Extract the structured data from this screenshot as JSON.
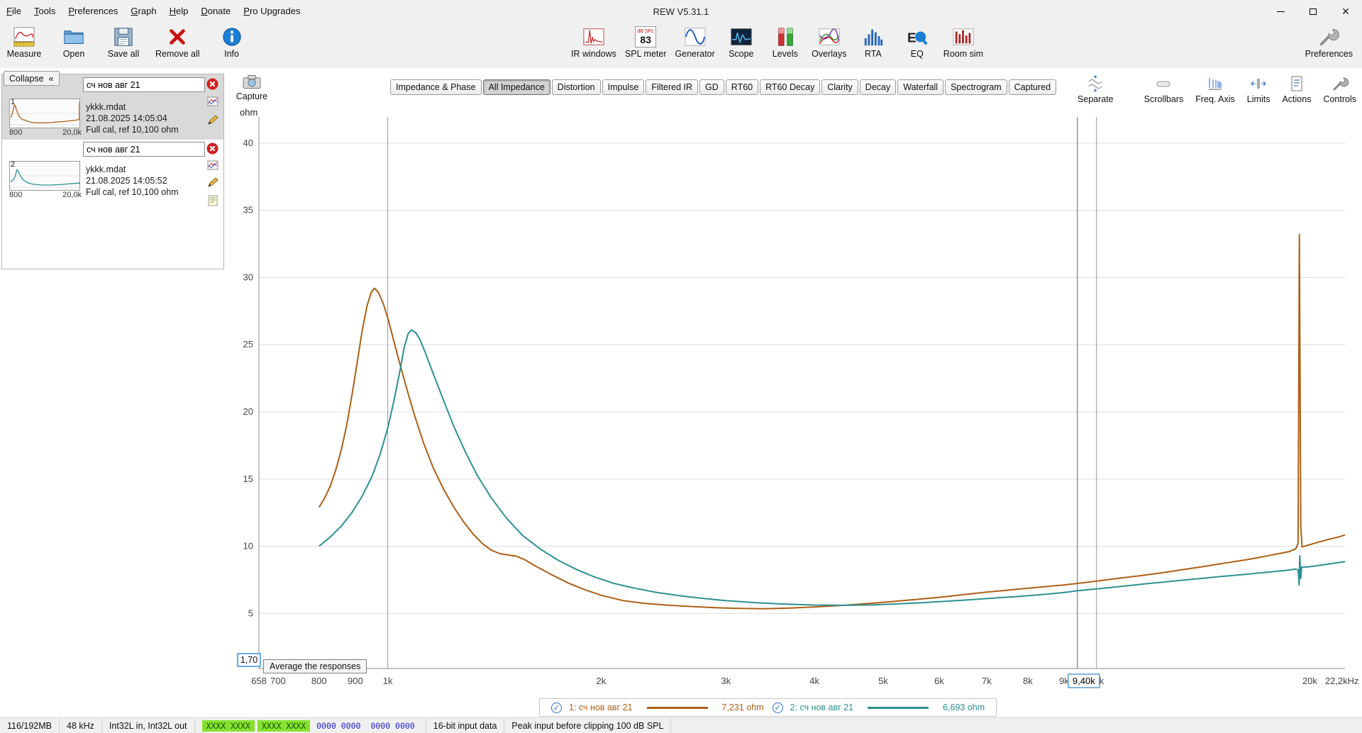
{
  "window": {
    "title": "REW V5.31.1"
  },
  "menu": {
    "items": [
      "File",
      "Tools",
      "Preferences",
      "Graph",
      "Help",
      "Donate",
      "Pro Upgrades"
    ]
  },
  "toolbar": {
    "left": [
      {
        "label": "Measure"
      },
      {
        "label": "Open"
      },
      {
        "label": "Save all"
      },
      {
        "label": "Remove all"
      },
      {
        "label": "Info"
      }
    ],
    "center": [
      {
        "label": "IR windows"
      },
      {
        "label": "SPL meter",
        "badge_top": "dB SPL",
        "badge_value": "83"
      },
      {
        "label": "Generator"
      },
      {
        "label": "Scope"
      },
      {
        "label": "Levels"
      },
      {
        "label": "Overlays"
      },
      {
        "label": "RTA"
      },
      {
        "label": "EQ"
      },
      {
        "label": "Room sim"
      }
    ],
    "right": [
      {
        "label": "Preferences"
      }
    ]
  },
  "sidebar": {
    "collapse_label": "Collapse",
    "entries": [
      {
        "index": "1",
        "name": "сч нов авг 21",
        "file": "ykkk.mdat",
        "timestamp": "21.08.2025 14:05:04",
        "cal": "Full cal, ref 10,100 ohm",
        "thumb_min": "800",
        "thumb_max": "20,0k"
      },
      {
        "index": "2",
        "name": "сч нов авг 21",
        "file": "ykkk.mdat",
        "timestamp": "21.08.2025 14:05:52",
        "cal": "Full cal, ref 10,100 ohm",
        "thumb_min": "800",
        "thumb_max": "20,0k"
      }
    ]
  },
  "graph_header": {
    "capture_label": "Capture",
    "tabs": [
      "Impedance & Phase",
      "All Impedance",
      "Distortion",
      "Impulse",
      "Filtered IR",
      "GD",
      "RT60",
      "RT60 Decay",
      "Clarity",
      "Decay",
      "Waterfall",
      "Spectrogram",
      "Captured"
    ],
    "selected_tab": "All Impedance",
    "right_buttons": [
      "Separate",
      "Scrollbars",
      "Freq. Axis",
      "Limits",
      "Actions",
      "Controls"
    ]
  },
  "graph_footer": {
    "axis_min_value": "1,70",
    "tooltip": "Average the responses"
  },
  "chart_data": {
    "type": "line",
    "title": "",
    "xlabel": "Hz",
    "ylabel": "ohm",
    "x_scale": "log",
    "grid": true,
    "legend_position": "bottom",
    "xlim": [
      658,
      22420
    ],
    "ylim": [
      0.9,
      41.95
    ],
    "y_ticks": [
      5,
      10,
      15,
      20,
      25,
      30,
      35,
      40
    ],
    "x_ticks": [
      {
        "f": 658,
        "label": "658"
      },
      {
        "f": 700,
        "label": "700"
      },
      {
        "f": 800,
        "label": "800"
      },
      {
        "f": 900,
        "label": "900"
      },
      {
        "f": 1000,
        "label": "1k"
      },
      {
        "f": 2000,
        "label": "2k"
      },
      {
        "f": 3000,
        "label": "3k"
      },
      {
        "f": 4000,
        "label": "4k"
      },
      {
        "f": 5000,
        "label": "5k"
      },
      {
        "f": 6000,
        "label": "6k"
      },
      {
        "f": 7000,
        "label": "7k"
      },
      {
        "f": 8000,
        "label": "8k"
      },
      {
        "f": 9000,
        "label": "9k"
      },
      {
        "f": 10000,
        "label": "10k"
      },
      {
        "f": 20000,
        "label": "20k"
      },
      {
        "f": 22200,
        "label": "22,2kHz"
      }
    ],
    "decade_gridlines": [
      1000,
      10000
    ],
    "cursor": {
      "freq": 9400,
      "label": "9,40k"
    },
    "series": [
      {
        "name": "1: сч нов авг 21",
        "color": "#ad5f16",
        "readout": "7,231 ohm",
        "checked": true,
        "points": [
          [
            800,
            12.9
          ],
          [
            815,
            13.6
          ],
          [
            830,
            14.5
          ],
          [
            845,
            15.7
          ],
          [
            860,
            17.2
          ],
          [
            875,
            19.0
          ],
          [
            890,
            21.2
          ],
          [
            905,
            23.6
          ],
          [
            920,
            26.0
          ],
          [
            935,
            27.9
          ],
          [
            948,
            28.9
          ],
          [
            958,
            29.2
          ],
          [
            970,
            28.9
          ],
          [
            985,
            28.1
          ],
          [
            1000,
            27.0
          ],
          [
            1015,
            25.7
          ],
          [
            1035,
            24.0
          ],
          [
            1060,
            22.0
          ],
          [
            1090,
            19.8
          ],
          [
            1125,
            17.6
          ],
          [
            1160,
            15.8
          ],
          [
            1200,
            14.2
          ],
          [
            1240,
            12.9
          ],
          [
            1280,
            11.8
          ],
          [
            1320,
            10.9
          ],
          [
            1360,
            10.2
          ],
          [
            1400,
            9.7
          ],
          [
            1440,
            9.45
          ],
          [
            1480,
            9.35
          ],
          [
            1520,
            9.25
          ],
          [
            1560,
            9.0
          ],
          [
            1620,
            8.5
          ],
          [
            1700,
            7.9
          ],
          [
            1800,
            7.25
          ],
          [
            1900,
            6.75
          ],
          [
            2000,
            6.35
          ],
          [
            2150,
            5.95
          ],
          [
            2300,
            5.75
          ],
          [
            2500,
            5.6
          ],
          [
            2700,
            5.5
          ],
          [
            2900,
            5.42
          ],
          [
            3100,
            5.38
          ],
          [
            3400,
            5.35
          ],
          [
            3700,
            5.4
          ],
          [
            4000,
            5.48
          ],
          [
            4400,
            5.6
          ],
          [
            4800,
            5.75
          ],
          [
            5200,
            5.9
          ],
          [
            5600,
            6.05
          ],
          [
            6000,
            6.2
          ],
          [
            6500,
            6.4
          ],
          [
            7000,
            6.58
          ],
          [
            7500,
            6.73
          ],
          [
            8000,
            6.88
          ],
          [
            8500,
            7.0
          ],
          [
            9000,
            7.12
          ],
          [
            9400,
            7.23
          ],
          [
            10000,
            7.4
          ],
          [
            10700,
            7.6
          ],
          [
            11500,
            7.8
          ],
          [
            12300,
            8.0
          ],
          [
            13200,
            8.25
          ],
          [
            14200,
            8.5
          ],
          [
            15200,
            8.75
          ],
          [
            16300,
            9.0
          ],
          [
            17500,
            9.3
          ],
          [
            18700,
            9.6
          ],
          [
            19100,
            9.8
          ],
          [
            19250,
            10.2
          ],
          [
            19330,
            33.2
          ],
          [
            19420,
            11.5
          ],
          [
            19500,
            9.95
          ],
          [
            19800,
            10.05
          ],
          [
            20400,
            10.25
          ],
          [
            21200,
            10.5
          ],
          [
            22000,
            10.7
          ],
          [
            22420,
            10.85
          ]
        ]
      },
      {
        "name": "2: сч нов авг 21",
        "color": "#2e9090",
        "readout": "6,693 ohm",
        "checked": true,
        "points": [
          [
            800,
            10.0
          ],
          [
            830,
            10.7
          ],
          [
            860,
            11.5
          ],
          [
            890,
            12.5
          ],
          [
            920,
            13.7
          ],
          [
            950,
            15.2
          ],
          [
            975,
            16.8
          ],
          [
            1000,
            18.8
          ],
          [
            1020,
            20.8
          ],
          [
            1040,
            23.0
          ],
          [
            1055,
            24.8
          ],
          [
            1068,
            25.8
          ],
          [
            1080,
            26.1
          ],
          [
            1095,
            25.9
          ],
          [
            1110,
            25.4
          ],
          [
            1130,
            24.4
          ],
          [
            1160,
            22.8
          ],
          [
            1200,
            20.8
          ],
          [
            1240,
            18.9
          ],
          [
            1290,
            16.9
          ],
          [
            1340,
            15.2
          ],
          [
            1400,
            13.6
          ],
          [
            1470,
            12.1
          ],
          [
            1550,
            10.8
          ],
          [
            1640,
            9.8
          ],
          [
            1740,
            8.95
          ],
          [
            1850,
            8.25
          ],
          [
            1960,
            7.7
          ],
          [
            2080,
            7.25
          ],
          [
            2220,
            6.9
          ],
          [
            2400,
            6.55
          ],
          [
            2600,
            6.3
          ],
          [
            2800,
            6.1
          ],
          [
            3000,
            5.95
          ],
          [
            3300,
            5.8
          ],
          [
            3600,
            5.7
          ],
          [
            4000,
            5.62
          ],
          [
            4400,
            5.6
          ],
          [
            4800,
            5.63
          ],
          [
            5200,
            5.7
          ],
          [
            5700,
            5.8
          ],
          [
            6200,
            5.92
          ],
          [
            6700,
            6.03
          ],
          [
            7200,
            6.15
          ],
          [
            7700,
            6.25
          ],
          [
            8200,
            6.36
          ],
          [
            8700,
            6.48
          ],
          [
            9100,
            6.58
          ],
          [
            9400,
            6.69
          ],
          [
            10000,
            6.82
          ],
          [
            10800,
            7.0
          ],
          [
            11700,
            7.2
          ],
          [
            12700,
            7.38
          ],
          [
            13700,
            7.55
          ],
          [
            14800,
            7.72
          ],
          [
            16000,
            7.88
          ],
          [
            17300,
            8.05
          ],
          [
            18500,
            8.2
          ],
          [
            19100,
            8.3
          ],
          [
            19250,
            8.25
          ],
          [
            19320,
            7.1
          ],
          [
            19360,
            9.3
          ],
          [
            19420,
            7.6
          ],
          [
            19480,
            8.45
          ],
          [
            19800,
            8.45
          ],
          [
            20500,
            8.55
          ],
          [
            21300,
            8.68
          ],
          [
            22420,
            8.85
          ]
        ]
      }
    ]
  },
  "status_bar": {
    "memory": "116/192MB",
    "sample_rate": "48 kHz",
    "io": "Int32L in, Int32L out",
    "meter_left": "XXXX XXXX",
    "meter_right": "XXXX XXXX",
    "counters_a": "0000 0000",
    "counters_b": "0000 0000",
    "input_format": "16-bit input data",
    "clipping": "Peak input before clipping 100 dB SPL"
  }
}
